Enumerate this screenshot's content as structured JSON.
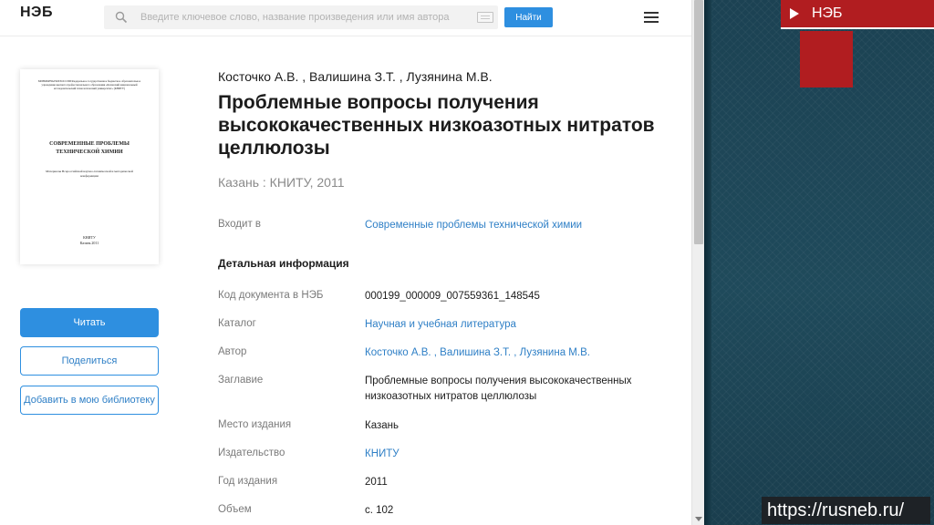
{
  "browser": {
    "logo": "НЭБ",
    "search": {
      "placeholder": "Введите ключевое слово, название произведения или имя автора",
      "icon": "search-icon"
    },
    "find_button": "Найти",
    "menu_icon": "hamburger-menu-icon"
  },
  "cover": {
    "header": "МИНОБРНАУКИ РОССИИ Федеральное государственное бюджетное образовательное учреждение высшего профессионального образования «Казанский национальный исследовательский технологический университет» (КНИТУ)",
    "title": "СОВРЕМЕННЫЕ ПРОБЛЕМЫ ТЕХНИЧЕСКОЙ ХИМИИ",
    "subtitle": "Материалы Всероссийской научно-технической и методической конференции",
    "footer_line1": "КНИТУ",
    "footer_line2": "Казань 2011"
  },
  "actions": {
    "read": "Читать",
    "share": "Поделиться",
    "add_to_library": "Добавить в мою библиотеку"
  },
  "record": {
    "authors": "Косточко А.В. , Валишина З.Т. , Лузянина М.В.",
    "title": "Проблемные вопросы получения высококачественных низкоазотных нитратов целлюлозы",
    "imprint": "Казань : КНИТУ, 2011",
    "part_of_label": "Входит в",
    "part_of_value": "Современные проблемы технической химии",
    "details_heading": "Детальная информация",
    "fields": [
      {
        "label": "Код документа в НЭБ",
        "value": "000199_000009_007559361_148545"
      },
      {
        "label": "Каталог",
        "value": "Научная и учебная литература"
      },
      {
        "label": "Автор",
        "value": "Косточко А.В. , Валишина З.Т. , Лузянина М.В."
      },
      {
        "label": "Заглавие",
        "value": "Проблемные вопросы получения высококачественных низкоазотных нитратов целлюлозы"
      },
      {
        "label": "Место издания",
        "value": "Казань"
      },
      {
        "label": "Издательство",
        "value": "КНИТУ"
      },
      {
        "label": "Год издания",
        "value": "2011"
      },
      {
        "label": "Объем",
        "value": "с. 102"
      }
    ]
  },
  "slide": {
    "nav_label": "НЭБ",
    "url": "https://rusneb.ru/",
    "accent": "#b11d20",
    "background": "#1d4656",
    "link_color": "#2e7fc6",
    "button_color": "#2e8fe0"
  }
}
